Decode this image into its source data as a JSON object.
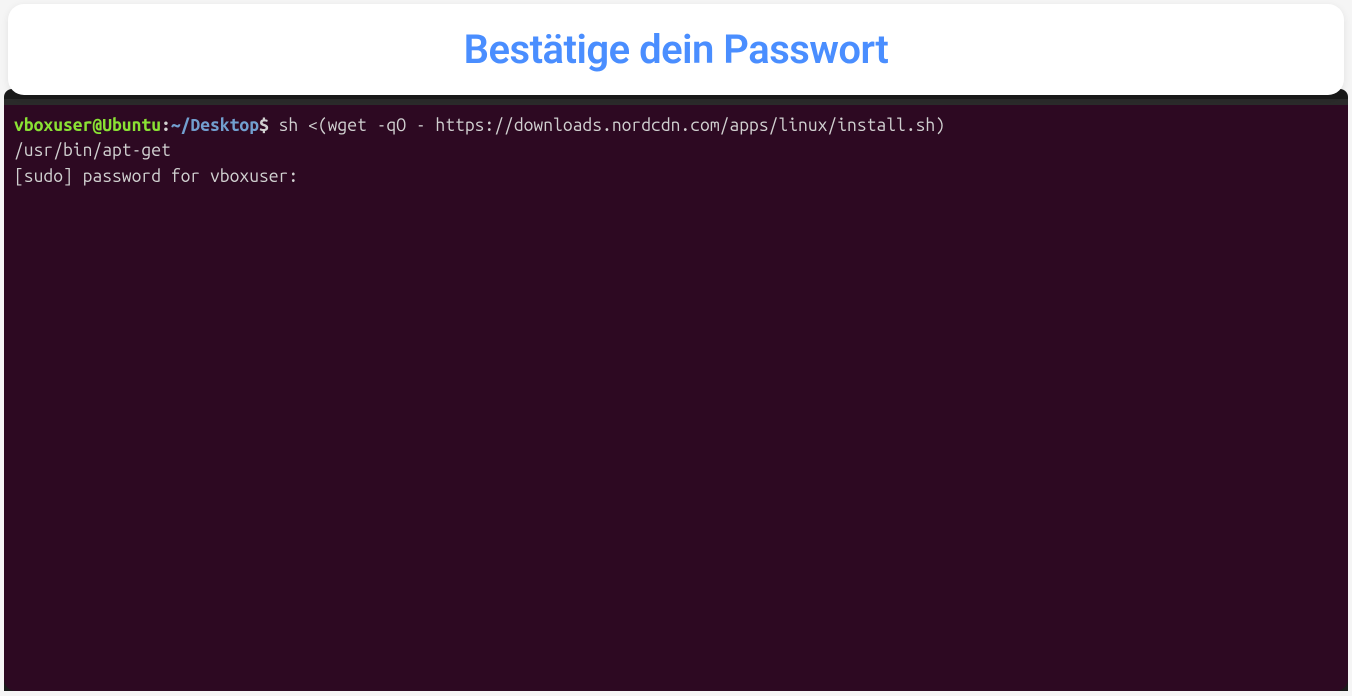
{
  "header": {
    "title": "Bestätige dein Passwort"
  },
  "terminal": {
    "prompt": {
      "user_host": "vboxuser@Ubuntu",
      "separator": ":",
      "path": "~/Desktop",
      "symbol": "$"
    },
    "command": " sh <(wget -qO - https://downloads.nordcdn.com/apps/linux/install.sh)",
    "output_line1": "/usr/bin/apt-get",
    "password_prompt": "[sudo] password for vboxuser: "
  }
}
